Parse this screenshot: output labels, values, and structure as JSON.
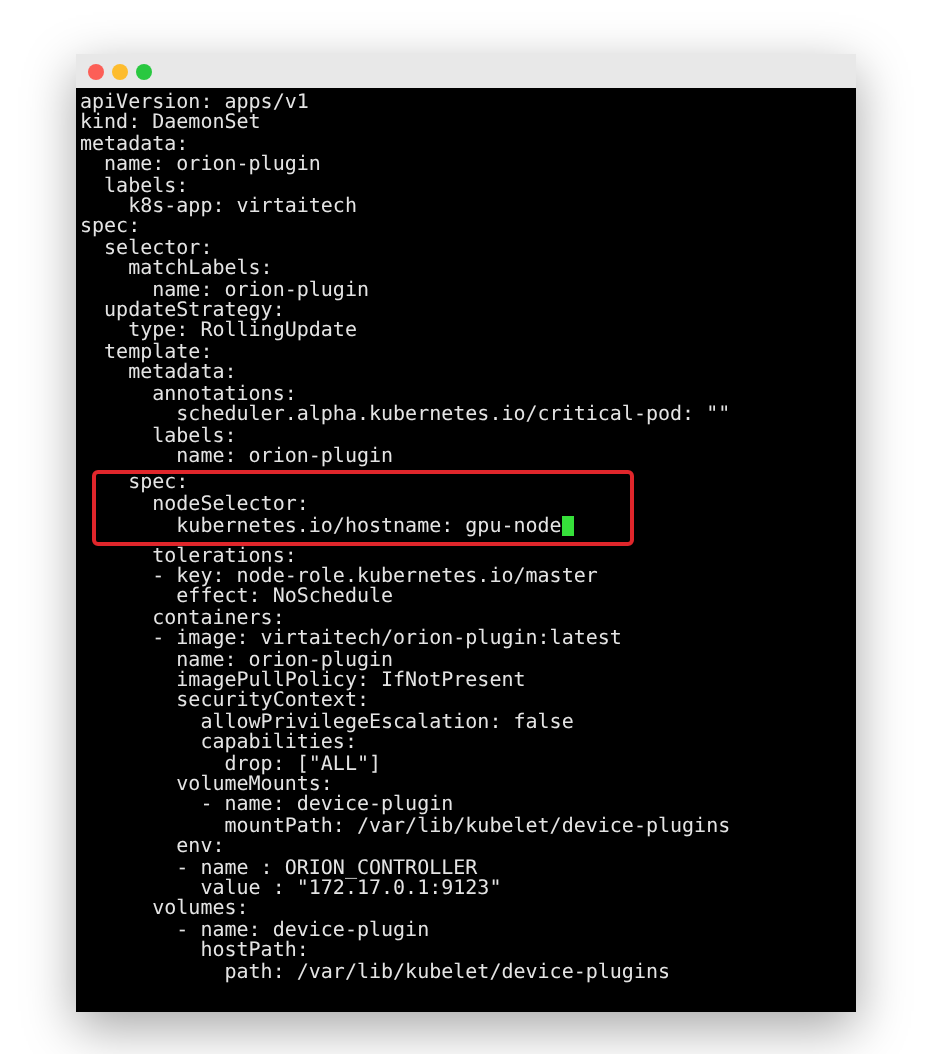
{
  "window": {
    "buttons": [
      {
        "color": "#fc5f57"
      },
      {
        "color": "#fdbc2e"
      },
      {
        "color": "#29c840"
      }
    ]
  },
  "lines": [
    {
      "text": "apiVersion: apps/v1",
      "highlighted": false,
      "cursor": false
    },
    {
      "text": "kind: DaemonSet",
      "highlighted": false,
      "cursor": false
    },
    {
      "text": "metadata:",
      "highlighted": false,
      "cursor": false
    },
    {
      "text": "  name: orion-plugin",
      "highlighted": false,
      "cursor": false
    },
    {
      "text": "  labels:",
      "highlighted": false,
      "cursor": false
    },
    {
      "text": "    k8s-app: virtaitech",
      "highlighted": false,
      "cursor": false
    },
    {
      "text": "spec:",
      "highlighted": false,
      "cursor": false
    },
    {
      "text": "  selector:",
      "highlighted": false,
      "cursor": false
    },
    {
      "text": "    matchLabels:",
      "highlighted": false,
      "cursor": false
    },
    {
      "text": "      name: orion-plugin",
      "highlighted": false,
      "cursor": false
    },
    {
      "text": "  updateStrategy:",
      "highlighted": false,
      "cursor": false
    },
    {
      "text": "    type: RollingUpdate",
      "highlighted": false,
      "cursor": false
    },
    {
      "text": "  template:",
      "highlighted": false,
      "cursor": false
    },
    {
      "text": "    metadata:",
      "highlighted": false,
      "cursor": false
    },
    {
      "text": "      annotations:",
      "highlighted": false,
      "cursor": false
    },
    {
      "text": "        scheduler.alpha.kubernetes.io/critical-pod: \"\"",
      "highlighted": false,
      "cursor": false
    },
    {
      "text": "      labels:",
      "highlighted": false,
      "cursor": false
    },
    {
      "text": "        name: orion-plugin",
      "highlighted": false,
      "cursor": false
    },
    {
      "text": "    spec:",
      "highlighted": true,
      "cursor": false
    },
    {
      "text": "      nodeSelector:",
      "highlighted": true,
      "cursor": false
    },
    {
      "text": "        kubernetes.io/hostname: gpu-node",
      "highlighted": true,
      "cursor": true
    },
    {
      "text": "      tolerations:",
      "highlighted": false,
      "cursor": false
    },
    {
      "text": "      - key: node-role.kubernetes.io/master",
      "highlighted": false,
      "cursor": false
    },
    {
      "text": "        effect: NoSchedule",
      "highlighted": false,
      "cursor": false
    },
    {
      "text": "      containers:",
      "highlighted": false,
      "cursor": false
    },
    {
      "text": "      - image: virtaitech/orion-plugin:latest",
      "highlighted": false,
      "cursor": false
    },
    {
      "text": "        name: orion-plugin",
      "highlighted": false,
      "cursor": false
    },
    {
      "text": "        imagePullPolicy: IfNotPresent",
      "highlighted": false,
      "cursor": false
    },
    {
      "text": "        securityContext:",
      "highlighted": false,
      "cursor": false
    },
    {
      "text": "          allowPrivilegeEscalation: false",
      "highlighted": false,
      "cursor": false
    },
    {
      "text": "          capabilities:",
      "highlighted": false,
      "cursor": false
    },
    {
      "text": "            drop: [\"ALL\"]",
      "highlighted": false,
      "cursor": false
    },
    {
      "text": "        volumeMounts:",
      "highlighted": false,
      "cursor": false
    },
    {
      "text": "          - name: device-plugin",
      "highlighted": false,
      "cursor": false
    },
    {
      "text": "            mountPath: /var/lib/kubelet/device-plugins",
      "highlighted": false,
      "cursor": false
    },
    {
      "text": "        env:",
      "highlighted": false,
      "cursor": false
    },
    {
      "text": "        - name : ORION_CONTROLLER",
      "highlighted": false,
      "cursor": false
    },
    {
      "text": "          value : \"172.17.0.1:9123\"",
      "highlighted": false,
      "cursor": false
    },
    {
      "text": "      volumes:",
      "highlighted": false,
      "cursor": false
    },
    {
      "text": "        - name: device-plugin",
      "highlighted": false,
      "cursor": false
    },
    {
      "text": "          hostPath:",
      "highlighted": false,
      "cursor": false
    },
    {
      "text": "            path: /var/lib/kubelet/device-plugins",
      "highlighted": false,
      "cursor": false
    }
  ]
}
